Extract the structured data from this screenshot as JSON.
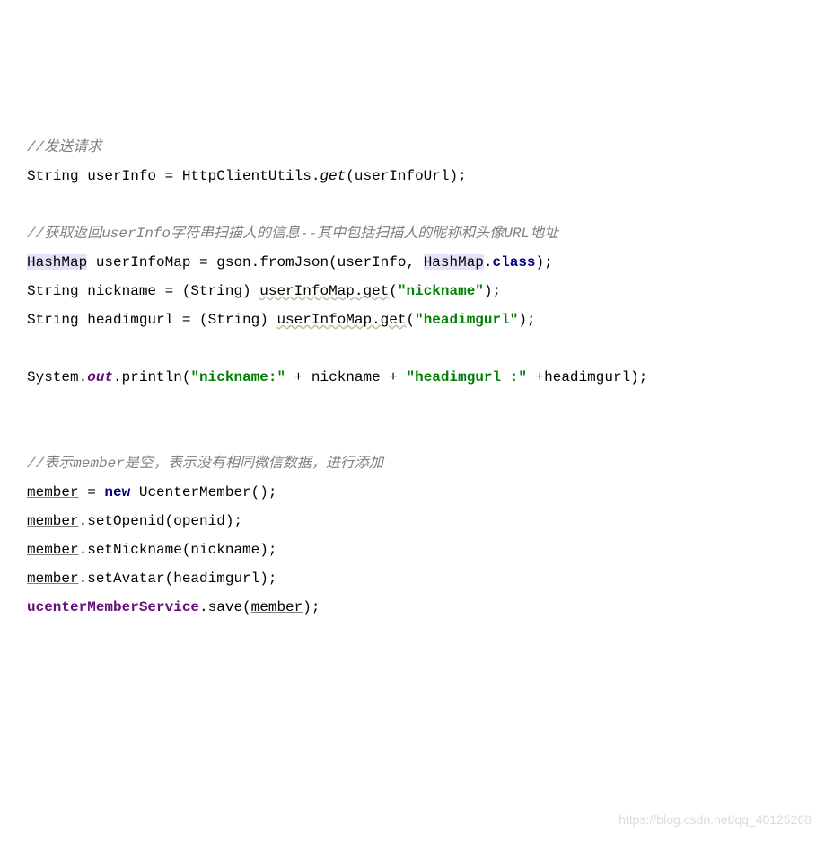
{
  "code": {
    "line1_comment": "//发送请求",
    "line2_p1": "String userInfo = HttpClientUtils.",
    "line2_get": "get",
    "line2_p2": "(userInfoUrl);",
    "line3_comment": "//获取返回userInfo字符串扫描人的信息--其中包括扫描人的昵称和头像URL地址",
    "line4_hashmap1": "HashMap",
    "line4_p1": " userInfoMap = gson.fromJson(userInfo, ",
    "line4_hashmap2": "HashMap",
    "line4_p2": ".",
    "line4_class": "class",
    "line4_p3": ");",
    "line5_p1": "String nickname = (String) ",
    "line5_p2": "userInfoMap.get",
    "line5_p3": "(",
    "line5_str": "\"nickname\"",
    "line5_p4": ");",
    "line6_p1": "String headimgurl = (String) ",
    "line6_p2": "userInfoMap.get",
    "line6_p3": "(",
    "line6_str": "\"headimgurl\"",
    "line6_p4": ");",
    "line7_p1": "System.",
    "line7_out": "out",
    "line7_p2": ".println(",
    "line7_str1": "\"nickname:\"",
    "line7_p3": " + nickname + ",
    "line7_str2": "\"headimgurl :\"",
    "line7_p4": " +headimgurl);",
    "line8_comment": "//表示member是空，表示没有相同微信数据，进行添加",
    "line9_p1": "member",
    "line9_p2": " = ",
    "line9_new": "new",
    "line9_p3": " UcenterMember();",
    "line10_p1": "member",
    "line10_p2": ".setOpenid(openid);",
    "line11_p1": "member",
    "line11_p2": ".setNickname(nickname);",
    "line12_p1": "member",
    "line12_p2": ".setAvatar(headimgurl);",
    "line13_p1": "ucenterMemberService",
    "line13_p2": ".save(",
    "line13_p3": "member",
    "line13_p4": ");"
  },
  "watermark": "https://blog.csdn.net/qq_40125268"
}
